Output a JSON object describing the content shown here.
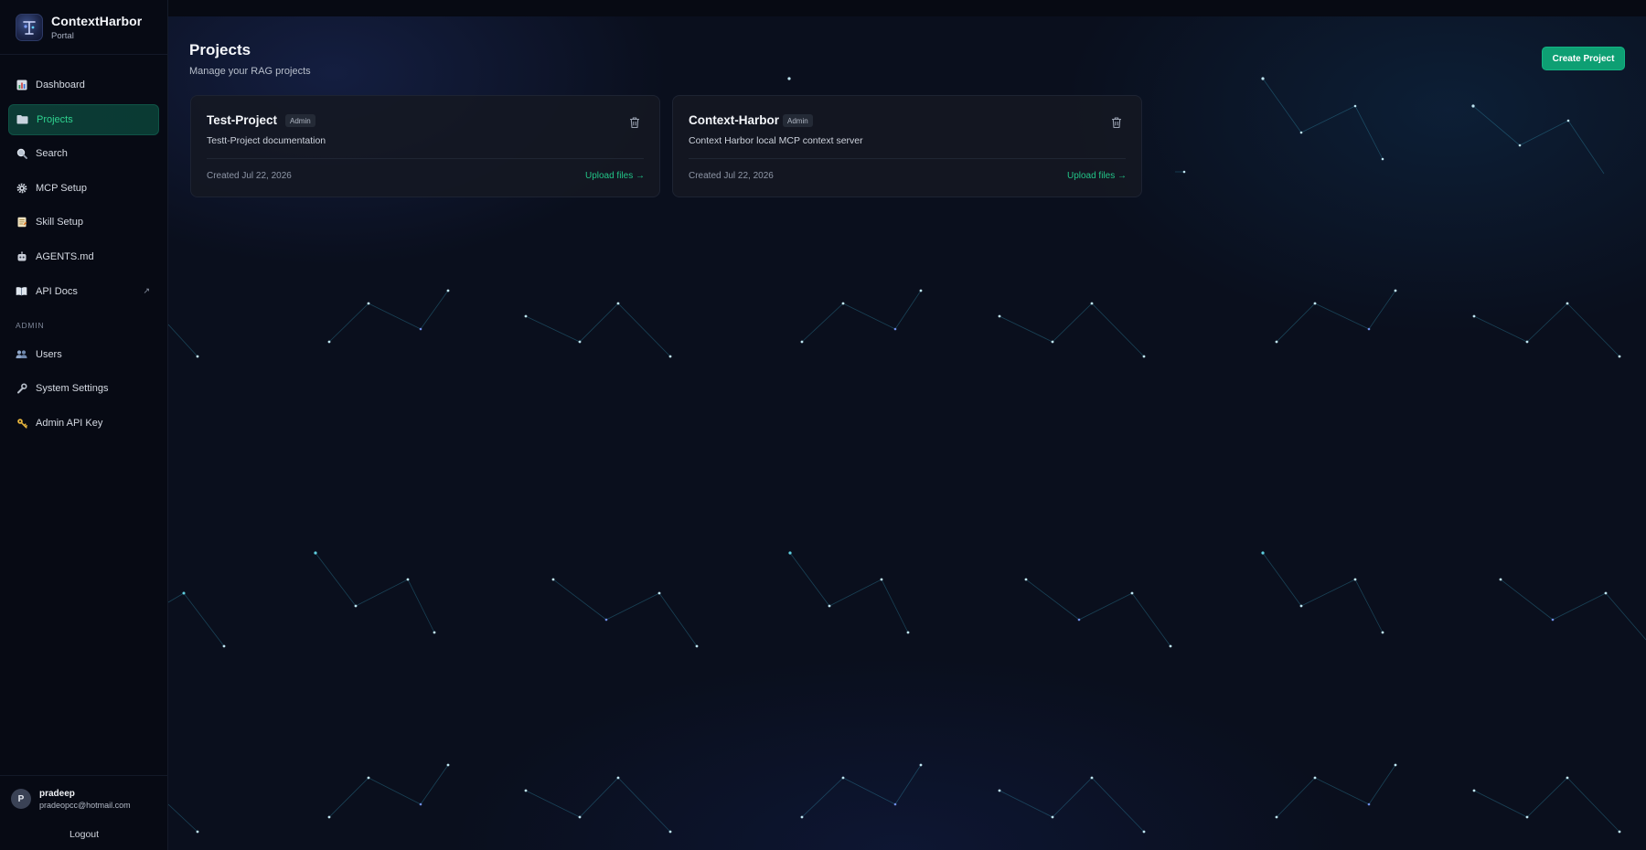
{
  "brand": {
    "name": "ContextHarbor",
    "subtitle": "Portal"
  },
  "sidebar": {
    "items": [
      {
        "label": "Dashboard",
        "icon": "chart-icon"
      },
      {
        "label": "Projects",
        "icon": "folder-icon",
        "active": true
      },
      {
        "label": "Search",
        "icon": "search-icon"
      },
      {
        "label": "MCP Setup",
        "icon": "gear-icon"
      },
      {
        "label": "Skill Setup",
        "icon": "scroll-icon"
      },
      {
        "label": "AGENTS.md",
        "icon": "robot-icon"
      },
      {
        "label": "API Docs",
        "icon": "book-icon",
        "external": true
      }
    ],
    "admin_label": "ADMIN",
    "admin_items": [
      {
        "label": "Users",
        "icon": "users-icon"
      },
      {
        "label": "System Settings",
        "icon": "wrench-icon"
      },
      {
        "label": "Admin API Key",
        "icon": "key-icon"
      }
    ]
  },
  "user": {
    "initial": "P",
    "name": "pradeep",
    "email": "pradeopcc@hotmail.com",
    "logout_label": "Logout"
  },
  "header": {
    "title": "Projects",
    "subtitle": "Manage your RAG projects",
    "create_button": "Create Project"
  },
  "projects": [
    {
      "name": "Test-Project",
      "badge": "Admin",
      "description": "Testt-Project documentation",
      "created": "Created Jul 22, 2026",
      "upload_label": "Upload files →"
    },
    {
      "name": "Context-Harbor",
      "badge": "Admin",
      "description": "Context Harbor local MCP context server",
      "created": "Created Jul 22, 2026",
      "upload_label": "Upload files →"
    }
  ],
  "colors": {
    "accent": "#0e9f73",
    "accent_text": "#22c487",
    "background": "#0a0f1d",
    "sidebar": "#070a14",
    "card": "#141822"
  }
}
